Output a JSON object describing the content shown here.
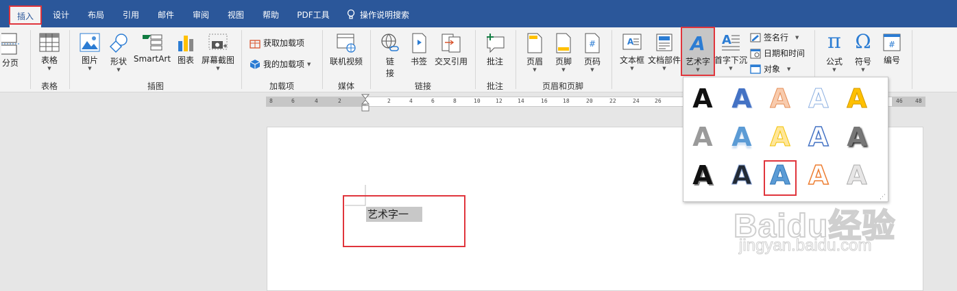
{
  "tabs": [
    {
      "label": "插入",
      "active": true
    },
    {
      "label": "设计"
    },
    {
      "label": "布局"
    },
    {
      "label": "引用"
    },
    {
      "label": "邮件"
    },
    {
      "label": "审阅"
    },
    {
      "label": "视图"
    },
    {
      "label": "帮助"
    },
    {
      "label": "PDF工具"
    },
    {
      "label": "操作说明搜索",
      "icon": "lightbulb-icon"
    }
  ],
  "ribbon": {
    "buttons": {
      "page_break": "分页",
      "table": "表格",
      "picture": "图片",
      "shapes": "形状",
      "smartart": "SmartArt",
      "chart": "图表",
      "screenshot": "屏幕截图",
      "get_addins": "获取加载项",
      "my_addins": "我的加载项",
      "online_video": "联机视频",
      "link_1": "链",
      "link_2": "接",
      "bookmark": "书签",
      "cross_ref": "交叉引用",
      "comment": "批注",
      "header": "页眉",
      "footer": "页脚",
      "page_number": "页码",
      "textbox": "文本框",
      "quick_parts": "文档部件",
      "wordart": "艺术字",
      "dropcap": "首字下沉",
      "signature": "签名行",
      "datetime": "日期和时间",
      "object": "对象",
      "equation": "公式",
      "symbol": "符号",
      "number": "编号"
    },
    "groups": {
      "tables": "表格",
      "illustrations": "插图",
      "addins": "加载项",
      "media": "媒体",
      "links": "链接",
      "comments": "批注",
      "header_footer": "页眉和页脚"
    }
  },
  "ruler": {
    "left": [
      "8",
      "6",
      "4",
      "2"
    ],
    "right": [
      "2",
      "4",
      "6",
      "8",
      "10",
      "12",
      "14",
      "16",
      "18",
      "20",
      "22",
      "24",
      "26"
    ],
    "far_right": [
      "46",
      "48"
    ]
  },
  "document": {
    "selected_text": "艺术字一"
  },
  "wordart_gallery": {
    "styles": [
      {
        "name": "wordart-style-1",
        "glyph": "A",
        "color": "#111111"
      },
      {
        "name": "wordart-style-2",
        "glyph": "A",
        "color": "#4472c4"
      },
      {
        "name": "wordart-style-3",
        "glyph": "A",
        "color": "#f4b183"
      },
      {
        "name": "wordart-style-4",
        "glyph": "A",
        "color": "#ffffff"
      },
      {
        "name": "wordart-style-5",
        "glyph": "A",
        "color": "#ffc000"
      },
      {
        "name": "wordart-style-6",
        "glyph": "A",
        "color": "#9a9a9a"
      },
      {
        "name": "wordart-style-7",
        "glyph": "A",
        "color": "#5b9bd5"
      },
      {
        "name": "wordart-style-8",
        "glyph": "A",
        "color": "#ffd966"
      },
      {
        "name": "wordart-style-9",
        "glyph": "A",
        "color": "#ffffff"
      },
      {
        "name": "wordart-style-10",
        "glyph": "A",
        "color": "#666666"
      },
      {
        "name": "wordart-style-11",
        "glyph": "A",
        "color": "#111111"
      },
      {
        "name": "wordart-style-12",
        "glyph": "A",
        "color": "#222a35"
      },
      {
        "name": "wordart-style-13",
        "glyph": "A",
        "color": "#5b9bd5",
        "highlighted": true
      },
      {
        "name": "wordart-style-14",
        "glyph": "A",
        "color": "#ffffff"
      },
      {
        "name": "wordart-style-15",
        "glyph": "A",
        "color": "#e7e6e6"
      }
    ]
  },
  "watermark": {
    "brand": "Baidu经验",
    "url": "jingyan.baidu.com"
  },
  "colors": {
    "titlebar": "#2b579a",
    "highlight": "#e0343b",
    "ribbon": "#f3f3f3"
  }
}
